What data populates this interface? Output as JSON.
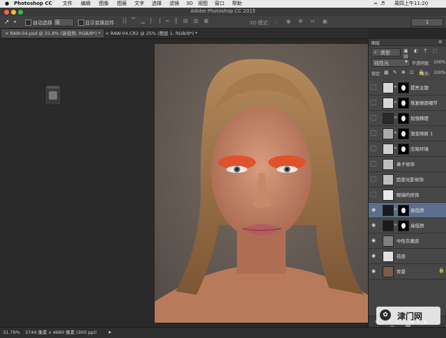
{
  "menubar": {
    "apple": "",
    "app": "Photoshop CC",
    "items": [
      "文件",
      "编辑",
      "图像",
      "图层",
      "文字",
      "选择",
      "滤镜",
      "3D",
      "视图",
      "窗口",
      "帮助"
    ],
    "clock": "周四上午11:20"
  },
  "window": {
    "title": "Adobe Photoshop CC 2015"
  },
  "options": {
    "auto_select_label": "自动选择:",
    "auto_select_value": "组",
    "show_transform_label": "显示变换控件",
    "mode_3d_label": "3D 模式:",
    "workspace_number": "1"
  },
  "tabs": [
    {
      "label": "RAW-04.psd @ 31.8% (高低频, RGB/8*) *",
      "active": true
    },
    {
      "label": "RAW-04.CR2 @ 25% (图层 1, RGB/8*) *",
      "active": false
    }
  ],
  "statusbar": {
    "zoom": "31.79%",
    "docinfo": "3744 像素 x 4680 像素 (300 ppi)"
  },
  "watermark": {
    "text": "津门网"
  },
  "layers_panel": {
    "tab_label": "图层",
    "filter_value": "类型",
    "blend_mode": "线性光",
    "opacity_label": "不透明度:",
    "opacity_value": "100%",
    "lock_label": "锁定:",
    "fill_label": "填充:",
    "fill_value": "100%",
    "layers": [
      {
        "name": "提亮主题",
        "visible": false,
        "thumb": "#d8d8d8",
        "mask": true,
        "selected": false
      },
      {
        "name": "恢复眼部细节",
        "visible": false,
        "thumb": "#d8d8d8",
        "mask": true,
        "selected": false
      },
      {
        "name": "加强精度",
        "visible": false,
        "thumb": "#2a2a2a",
        "mask": true,
        "selected": false
      },
      {
        "name": "渐变映射 1",
        "visible": false,
        "thumb": "#aaaaaa",
        "mask": true,
        "selected": false
      },
      {
        "name": "压暗环境",
        "visible": false,
        "thumb": "#cfcfcf",
        "mask": true,
        "selected": false
      },
      {
        "name": "鼻子修饰",
        "visible": false,
        "thumb": "#bdbdbd",
        "mask": false,
        "selected": false
      },
      {
        "name": "脸部光影修饰",
        "visible": false,
        "thumb": "#bdbdbd",
        "mask": false,
        "selected": false
      },
      {
        "name": "眼镜的修饰",
        "visible": false,
        "thumb": "#e8e8e8",
        "mask": false,
        "selected": false
      },
      {
        "name": "高低频",
        "visible": true,
        "thumb": "#1a1a1a",
        "mask": true,
        "selected": true
      },
      {
        "name": "高低频",
        "visible": true,
        "thumb": "#1a1a1a",
        "mask": true,
        "selected": false
      },
      {
        "name": "中性灰磨皮",
        "visible": true,
        "thumb": "#808080",
        "mask": false,
        "selected": false
      },
      {
        "name": "祛痘",
        "visible": true,
        "thumb": "#e0e0e0",
        "mask": false,
        "selected": false
      },
      {
        "name": "背景",
        "visible": true,
        "thumb": "#7a5c4a",
        "mask": false,
        "selected": false
      }
    ]
  },
  "colors": {
    "accent_selected": "#5b6f8d",
    "panel_bg": "#444444",
    "canvas_bg": "#2a2a2a"
  }
}
